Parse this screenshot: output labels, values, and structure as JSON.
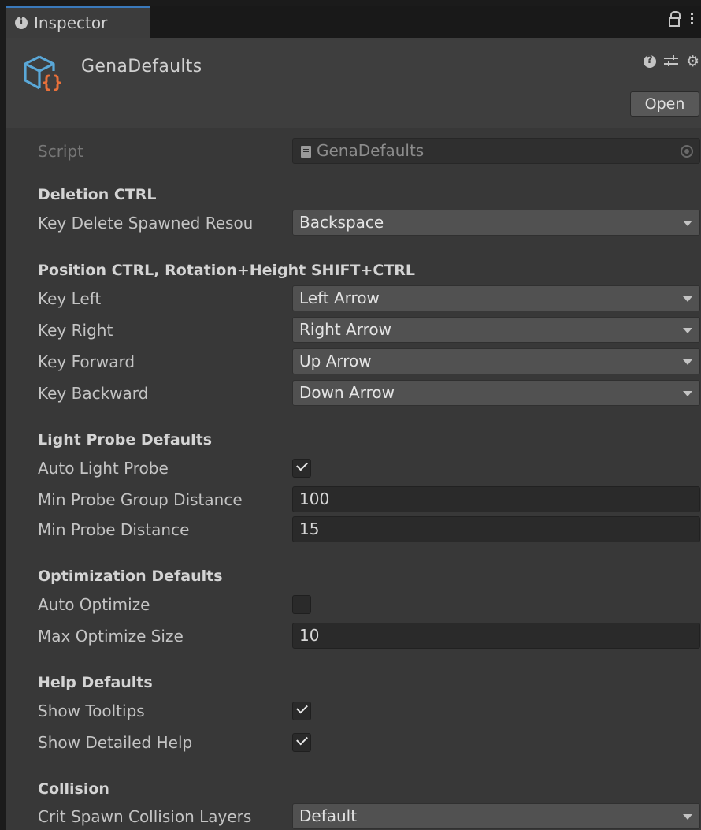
{
  "tab": {
    "label": "Inspector"
  },
  "header": {
    "title": "GenaDefaults",
    "open_label": "Open"
  },
  "script_field": {
    "label": "Script",
    "value": "GenaDefaults"
  },
  "sections": {
    "deletion": {
      "header": "Deletion CTRL",
      "key_delete": {
        "label": "Key Delete Spawned Resou",
        "value": "Backspace"
      }
    },
    "position": {
      "header": "Position CTRL, Rotation+Height SHIFT+CTRL",
      "key_left": {
        "label": "Key Left",
        "value": "Left Arrow"
      },
      "key_right": {
        "label": "Key Right",
        "value": "Right Arrow"
      },
      "key_forward": {
        "label": "Key Forward",
        "value": "Up Arrow"
      },
      "key_backward": {
        "label": "Key Backward",
        "value": "Down Arrow"
      }
    },
    "light_probe": {
      "header": "Light Probe Defaults",
      "auto_light_probe": {
        "label": "Auto Light Probe",
        "checked": true
      },
      "min_probe_group_distance": {
        "label": "Min Probe Group Distance",
        "value": "100"
      },
      "min_probe_distance": {
        "label": "Min Probe Distance",
        "value": "15"
      }
    },
    "optimization": {
      "header": "Optimization Defaults",
      "auto_optimize": {
        "label": "Auto Optimize",
        "checked": false
      },
      "max_optimize_size": {
        "label": "Max Optimize Size",
        "value": "10"
      }
    },
    "help": {
      "header": "Help Defaults",
      "show_tooltips": {
        "label": "Show Tooltips",
        "checked": true
      },
      "show_detailed_help": {
        "label": "Show Detailed Help",
        "checked": true
      }
    },
    "collision": {
      "header": "Collision",
      "crit_spawn_layers": {
        "label": "Crit Spawn Collision Layers",
        "value": "Default"
      }
    }
  },
  "icons": {
    "tab": "info-icon",
    "asset": "scriptable-object-icon",
    "lock": "lock-icon",
    "menu": "kebab-menu-icon",
    "help": "help-icon",
    "presets": "presets-icon",
    "settings": "gear-icon",
    "dropdown": "chevron-down-icon"
  },
  "colors": {
    "accent_tab": "#3a79bb",
    "asset_icon_blue": "#5aa8d8",
    "asset_icon_orange": "#e8703a"
  }
}
